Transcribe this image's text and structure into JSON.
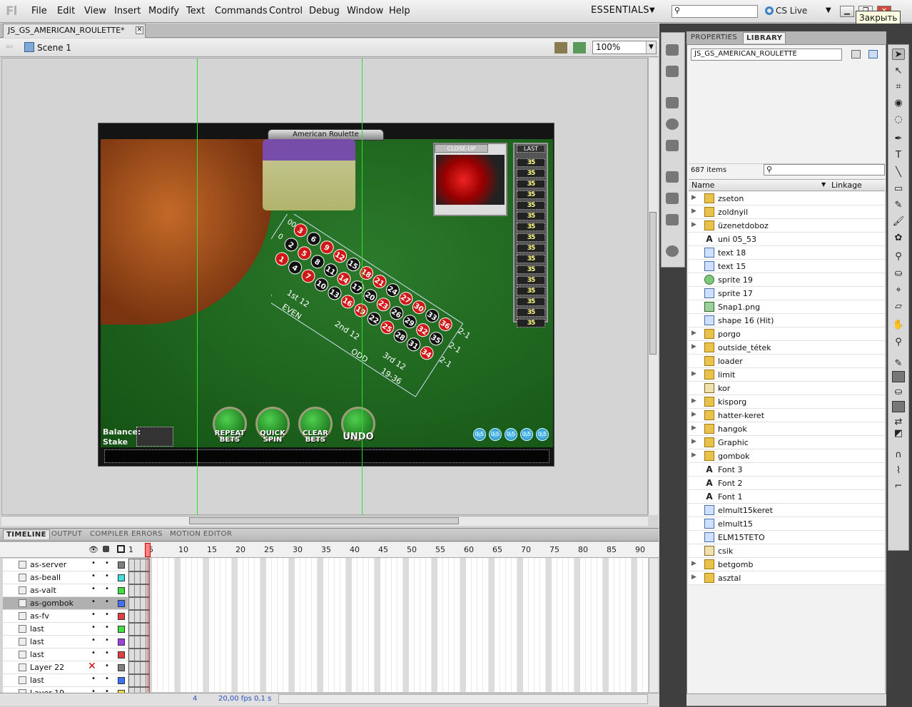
{
  "app": {
    "logo": "Fl",
    "menus": [
      "File",
      "Edit",
      "View",
      "Insert",
      "Modify",
      "Text",
      "Commands",
      "Control",
      "Debug",
      "Window",
      "Help"
    ],
    "workspace": "ESSENTIALS",
    "cs_live": "CS Live",
    "tooltip": "Закрыть"
  },
  "document": {
    "tab": "JS_GS_AMERICAN_ROULETTE*",
    "scene": "Scene 1",
    "zoom": "100%"
  },
  "stage": {
    "game_title": "American Roulette",
    "closeup_label": "CLOSE-UP",
    "last_label": "LAST",
    "last_values": [
      "35",
      "35",
      "35",
      "35",
      "35",
      "35",
      "35",
      "35",
      "35",
      "35",
      "35",
      "35",
      "35",
      "35",
      "35",
      "35"
    ],
    "balance_label": "Balance:",
    "stake_label": "Stake",
    "buttons": [
      {
        "label": "REPEAT BETS"
      },
      {
        "label": "QUICK SPIN"
      },
      {
        "label": "CLEAR BETS"
      },
      {
        "label": "UNDO"
      }
    ],
    "chip_values": [
      "0.5",
      "0.5",
      "0.5",
      "0.5",
      "0.5"
    ],
    "board_labels": [
      "1st 12",
      "2nd 12",
      "3rd 12",
      "1-18",
      "EVEN",
      "ODD",
      "19-36",
      "2-1",
      "2-1",
      "2-1"
    ],
    "numbers": [
      "00",
      "0",
      "3",
      "2",
      "1",
      "6",
      "5",
      "4",
      "9",
      "8",
      "7",
      "12",
      "11",
      "10",
      "15",
      "14",
      "13",
      "18",
      "17",
      "16",
      "21",
      "20",
      "19",
      "24",
      "23",
      "22",
      "27",
      "26",
      "25",
      "30",
      "29",
      "28",
      "33",
      "32",
      "31",
      "36",
      "35",
      "34"
    ]
  },
  "timeline": {
    "tabs": [
      "TIMELINE",
      "OUTPUT",
      "COMPILER ERRORS",
      "MOTION EDITOR"
    ],
    "frame_numbers": [
      "1",
      "5",
      "10",
      "15",
      "20",
      "25",
      "30",
      "35",
      "40",
      "45",
      "50",
      "55",
      "60",
      "65",
      "70",
      "75",
      "80",
      "85",
      "90"
    ],
    "layers": [
      {
        "name": "as-server",
        "color": "#808080"
      },
      {
        "name": "as-beall",
        "color": "#40e0e0"
      },
      {
        "name": "as-valt",
        "color": "#40e040"
      },
      {
        "name": "as-gombok",
        "color": "#4070ff",
        "selected": true
      },
      {
        "name": "as-fv",
        "color": "#e04040"
      },
      {
        "name": "last",
        "color": "#40e040"
      },
      {
        "name": "last",
        "color": "#a040e0"
      },
      {
        "name": "last",
        "color": "#e04040"
      },
      {
        "name": "Layer 22",
        "color": "#808080"
      },
      {
        "name": "last",
        "color": "#4070ff"
      },
      {
        "name": "Layer 19",
        "color": "#f0e040"
      }
    ],
    "current_frame": "4",
    "fps": "20,00 fps",
    "time": "0,1 s"
  },
  "library": {
    "tabs": [
      "PROPERTIES",
      "LIBRARY"
    ],
    "document": "JS_GS_AMERICAN_ROULETTE",
    "item_count": "687 items",
    "col_name": "Name",
    "col_linkage": "Linkage",
    "items": [
      {
        "name": "zseton",
        "type": "folder",
        "expand": "▶"
      },
      {
        "name": "zoldnyil",
        "type": "folder",
        "expand": "▶"
      },
      {
        "name": "üzenetdoboz",
        "type": "folder",
        "expand": "▶"
      },
      {
        "name": "uni 05_53",
        "type": "font",
        "expand": ""
      },
      {
        "name": "text 18",
        "type": "gfx",
        "expand": ""
      },
      {
        "name": "text 15",
        "type": "gfx",
        "expand": ""
      },
      {
        "name": "sprite 19",
        "type": "sprite",
        "expand": ""
      },
      {
        "name": "sprite 17",
        "type": "gfx",
        "expand": ""
      },
      {
        "name": "Snap1.png",
        "type": "bmp",
        "expand": ""
      },
      {
        "name": "shape 16 (Hit)",
        "type": "gfx",
        "expand": ""
      },
      {
        "name": "porgo",
        "type": "folder",
        "expand": "▶"
      },
      {
        "name": "outside_tétek",
        "type": "folder",
        "expand": "▶"
      },
      {
        "name": "loader",
        "type": "folder",
        "expand": ""
      },
      {
        "name": "limit",
        "type": "folder",
        "expand": "▶"
      },
      {
        "name": "kor",
        "type": "btn",
        "expand": ""
      },
      {
        "name": "kisporg",
        "type": "folder",
        "expand": "▶"
      },
      {
        "name": "hatter-keret",
        "type": "folder",
        "expand": "▶"
      },
      {
        "name": "hangok",
        "type": "folder",
        "expand": "▶"
      },
      {
        "name": "Graphic",
        "type": "folder",
        "expand": "▶"
      },
      {
        "name": "gombok",
        "type": "folder",
        "expand": "▶"
      },
      {
        "name": "Font 3",
        "type": "font",
        "expand": ""
      },
      {
        "name": "Font 2",
        "type": "font",
        "expand": ""
      },
      {
        "name": "Font 1",
        "type": "font",
        "expand": ""
      },
      {
        "name": "elmult15keret",
        "type": "gfx",
        "expand": ""
      },
      {
        "name": "elmult15",
        "type": "gfx",
        "expand": ""
      },
      {
        "name": "ELM15TETO",
        "type": "gfx",
        "expand": ""
      },
      {
        "name": "csik",
        "type": "btn",
        "expand": ""
      },
      {
        "name": "betgomb",
        "type": "folder",
        "expand": "▶"
      },
      {
        "name": "asztal",
        "type": "folder",
        "expand": "▶"
      }
    ]
  }
}
